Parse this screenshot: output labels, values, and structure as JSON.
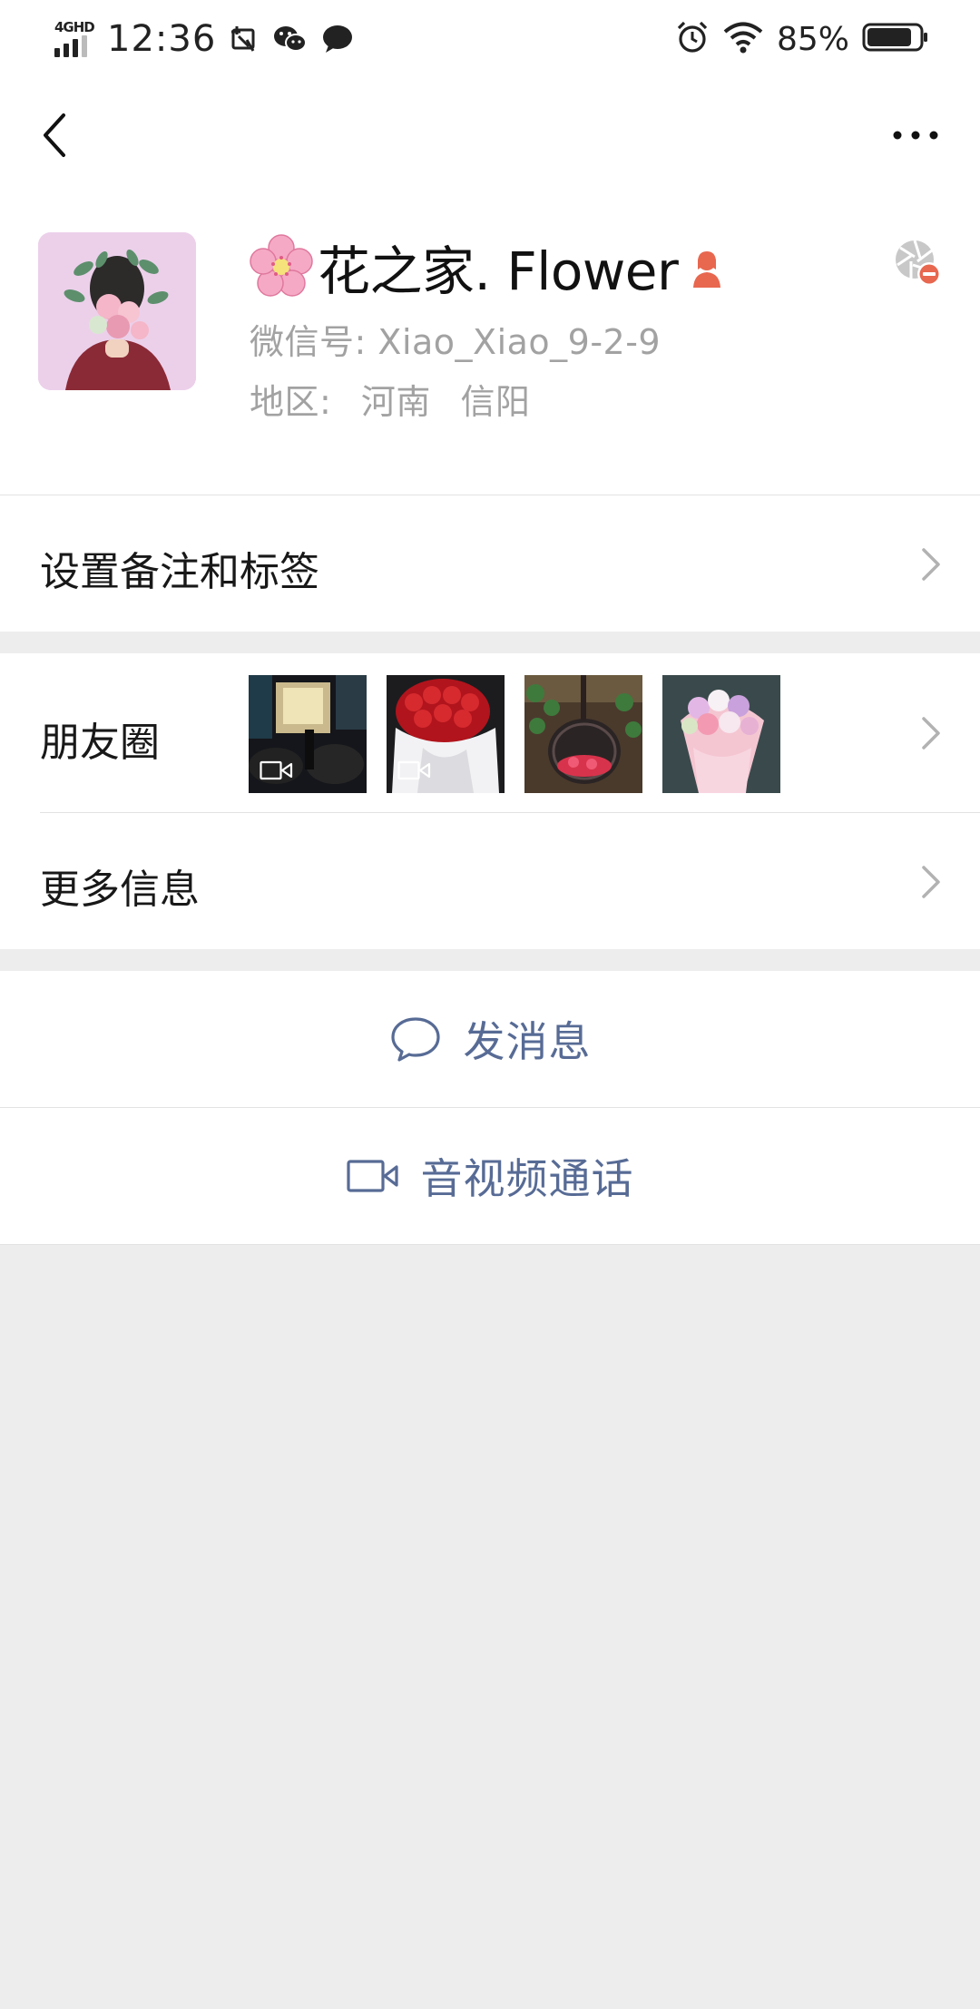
{
  "status_bar": {
    "network": "4GHD",
    "time": "12:36",
    "battery_percent": "85%",
    "battery_level": 0.85,
    "icons": [
      "signal-icon",
      "screenshot-icon",
      "wechat-icon",
      "message-icon",
      "alarm-icon",
      "wifi-icon",
      "battery-icon"
    ]
  },
  "nav": {
    "back_icon": "chevron-left-icon",
    "more_icon": "more-dots-icon"
  },
  "profile": {
    "name": "花之家. Flower",
    "name_emoji": "cherry-blossom-icon",
    "gender_icon": "female-person-icon",
    "wechat_id_label": "微信号:",
    "wechat_id": "Xiao_Xiao_9-2-9",
    "region_label": "地区:",
    "region_province": "河南",
    "region_city": "信阳",
    "moments_blocked_icon": "aperture-blocked-icon"
  },
  "rows": {
    "remark": {
      "label": "设置备注和标签"
    },
    "moments": {
      "label": "朋友圈",
      "thumbnails": [
        {
          "name": "moment-thumb-shop-night",
          "is_video": true
        },
        {
          "name": "moment-thumb-red-roses",
          "is_video": true
        },
        {
          "name": "moment-thumb-flower-swing",
          "is_video": false
        },
        {
          "name": "moment-thumb-pink-bouquet",
          "is_video": false
        }
      ]
    },
    "more_info": {
      "label": "更多信息"
    }
  },
  "actions": {
    "send_message": {
      "label": "发消息",
      "icon": "chat-bubble-icon"
    },
    "av_call": {
      "label": "音视频通话",
      "icon": "video-camera-icon"
    }
  },
  "colors": {
    "link_blue": "#576b95",
    "secondary_text": "#a2a2a2",
    "page_bg": "#ededed",
    "accent_red": "#e8674f"
  }
}
